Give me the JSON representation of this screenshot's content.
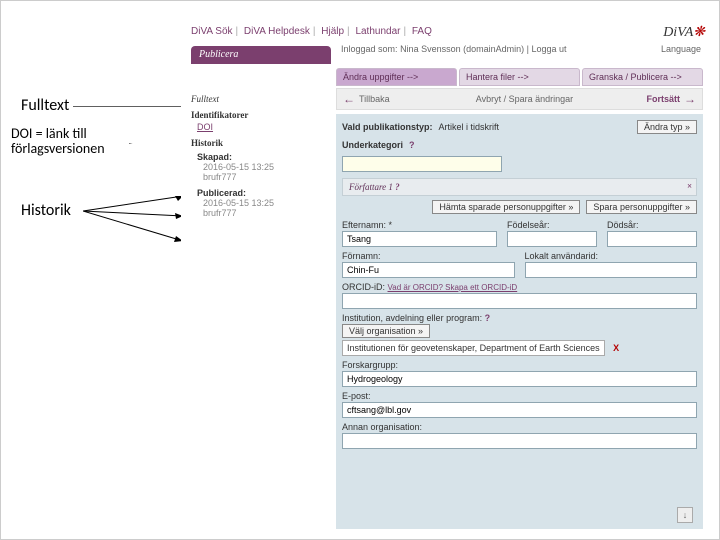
{
  "annotations": {
    "fulltext": "Fulltext",
    "doi_line1": "DOI = länk till",
    "doi_line2": "förlagsversionen",
    "historik": "Historik"
  },
  "topnav": {
    "items": [
      "DiVA Sök",
      "DiVA Helpdesk",
      "Hjälp",
      "Lathundar",
      "FAQ"
    ],
    "logo": "DiVA",
    "meta_prefix": "Inloggad som:",
    "meta_user": "Nina Svensson (domainAdmin)",
    "meta_links": "Logga ut",
    "language": "Language"
  },
  "main_tab": "Publicera",
  "step_tabs": [
    "Ändra uppgifter -->",
    "Hantera filer -->",
    "Granska / Publicera -->"
  ],
  "actionbar": {
    "back": "Tillbaka",
    "middle": "Avbryt / Spara ändringar",
    "forward": "Fortsätt"
  },
  "left_panel": {
    "fulltext_h": "Fulltext",
    "ident_h": "Identifikatorer",
    "doi_link": "DOI",
    "hist_h": "Historik",
    "created_lbl": "Skapad:",
    "created_val": "2016-05-15 13:25",
    "created_by": "brufr777",
    "pub_lbl": "Publicerad:",
    "pub_val": "2016-05-15 13:25",
    "pub_by": "brufr777"
  },
  "form": {
    "vald_label": "Vald publikationstyp:",
    "vald_value": "Artikel i tidskrift",
    "change_type_btn": "Ändra typ »",
    "subcat_label": "Underkategori",
    "author_header": "Författare 1",
    "btn_fetch": "Hämta sparade personuppgifter »",
    "btn_save": "Spara personuppgifter »",
    "efternamn_lbl": "Efternamn: *",
    "efternamn_val": "Tsang",
    "fodelse_lbl": "Födelseår:",
    "dods_lbl": "Dödsår:",
    "fornamn_lbl": "Förnamn:",
    "fornamn_val": "Chin-Fu",
    "lokalt_lbl": "Lokalt användarid:",
    "orcid_lbl": "ORCID-iD:",
    "orcid_hint": "Vad är ORCID? Skapa ett ORCID-iD",
    "inst_lbl": "Institution, avdelning eller program:",
    "inst_btn": "Välj organisation »",
    "inst_val": "Institutionen för geovetenskaper, Department of Earth Sciences",
    "grp_lbl": "Forskargrupp:",
    "grp_val": "Hydrogeology",
    "epost_lbl": "E-post:",
    "epost_val": "cftsang@lbl.gov",
    "other_lbl": "Annan organisation:"
  }
}
